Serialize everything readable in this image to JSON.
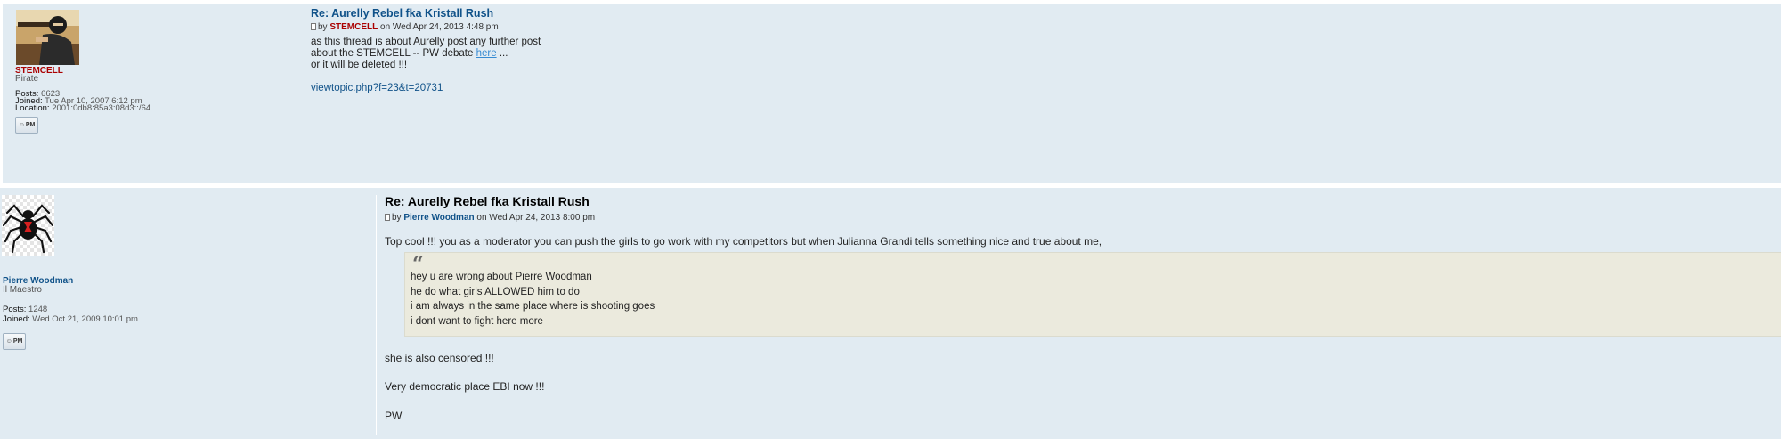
{
  "posts": [
    {
      "user": {
        "name": "STEMCELL",
        "rank": "Pirate",
        "posts_label": "Posts:",
        "posts": "6623",
        "joined_label": "Joined:",
        "joined": "Tue Apr 10, 2007 6:12 pm",
        "location_label": "Location:",
        "location": "2001:0db8:85a3:08d3::/64",
        "pm_label": "PM",
        "name_color": "#aa0000"
      },
      "title": "Re: Aurelly Rebel fka Kristall Rush",
      "byline": {
        "by": "by",
        "author": "STEMCELL",
        "date": "on Wed Apr 24, 2013 4:48 pm"
      },
      "body": {
        "line1": "as this thread is about Aurelly post any further post",
        "line2_prefix": "about the STEMCELL -- PW debate",
        "line2_link": "here",
        "line2_suffix": "...",
        "line3": "or it will be deleted !!!",
        "link": "viewtopic.php?f=23&t=20731"
      }
    },
    {
      "user": {
        "name": "Pierre Woodman",
        "rank": "Il Maestro",
        "posts_label": "Posts:",
        "posts": "1248",
        "joined_label": "Joined:",
        "joined": "Wed Oct 21, 2009 10:01 pm",
        "pm_label": "PM",
        "name_color": "#105289"
      },
      "title": "Re: Aurelly Rebel fka Kristall Rush",
      "byline": {
        "by": "by",
        "author": "Pierre Woodman",
        "date": "on Wed Apr 24, 2013 8:00 pm"
      },
      "body": {
        "line1": "Top cool !!! you as a moderator you can push the girls to go work with my competitors but when Julianna Grandi tells something nice and true about me,",
        "quote": [
          "hey u are wrong about Pierre Woodman",
          "he do what girls ALLOWED him to do",
          "i am always in the same place where is shooting goes",
          "i dont want to fight here more"
        ],
        "line2": "she is also censored !!!",
        "line3": "Very democratic place EBI now !!!",
        "line4": "PW"
      }
    }
  ],
  "colors": {
    "post_bg": "#e1ebf2",
    "link": "#105289",
    "quote_bg": "#ebeadd"
  }
}
